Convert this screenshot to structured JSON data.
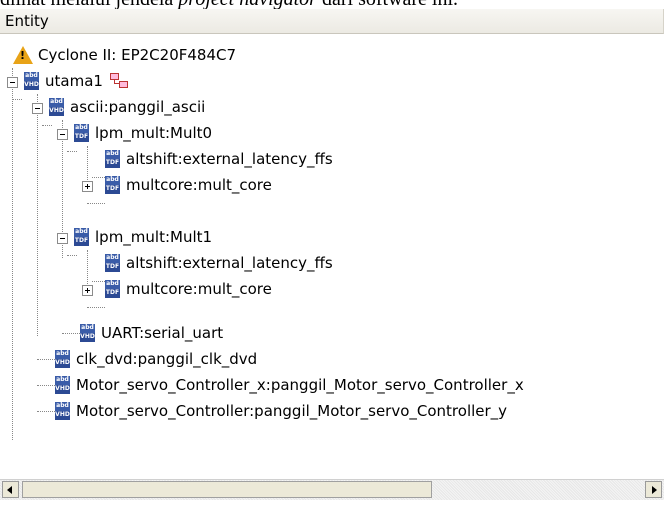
{
  "caption": {
    "before": "dlihat melalui jendela ",
    "italic": "project navigator",
    "after": " dari software ini."
  },
  "header": {
    "column": "Entity"
  },
  "tree": {
    "device": "Cyclone II: EP2C20F484C7",
    "items": [
      {
        "label": "utama1",
        "icon": "VHD"
      },
      {
        "label": "ascii:panggil_ascii",
        "icon": "VHD"
      },
      {
        "label": "lpm_mult:Mult0",
        "icon": "TDF"
      },
      {
        "label": "altshift:external_latency_ffs",
        "icon": "TDF"
      },
      {
        "label": "multcore:mult_core",
        "icon": "TDF"
      },
      {
        "label": "lpm_mult:Mult1",
        "icon": "TDF"
      },
      {
        "label": "altshift:external_latency_ffs",
        "icon": "TDF"
      },
      {
        "label": "multcore:mult_core",
        "icon": "TDF"
      },
      {
        "label": "UART:serial_uart",
        "icon": "VHD"
      },
      {
        "label": "clk_dvd:panggil_clk_dvd",
        "icon": "VHD"
      },
      {
        "label": "Motor_servo_Controller_x:panggil_Motor_servo_Controller_x",
        "icon": "VHD"
      },
      {
        "label": "Motor_servo_Controller:panggil_Motor_servo_Controller_y",
        "icon": "VHD"
      }
    ]
  },
  "icon_top": "abd",
  "colors": {
    "warning": "#e8a317",
    "file_icon": "#3a5ca8"
  }
}
